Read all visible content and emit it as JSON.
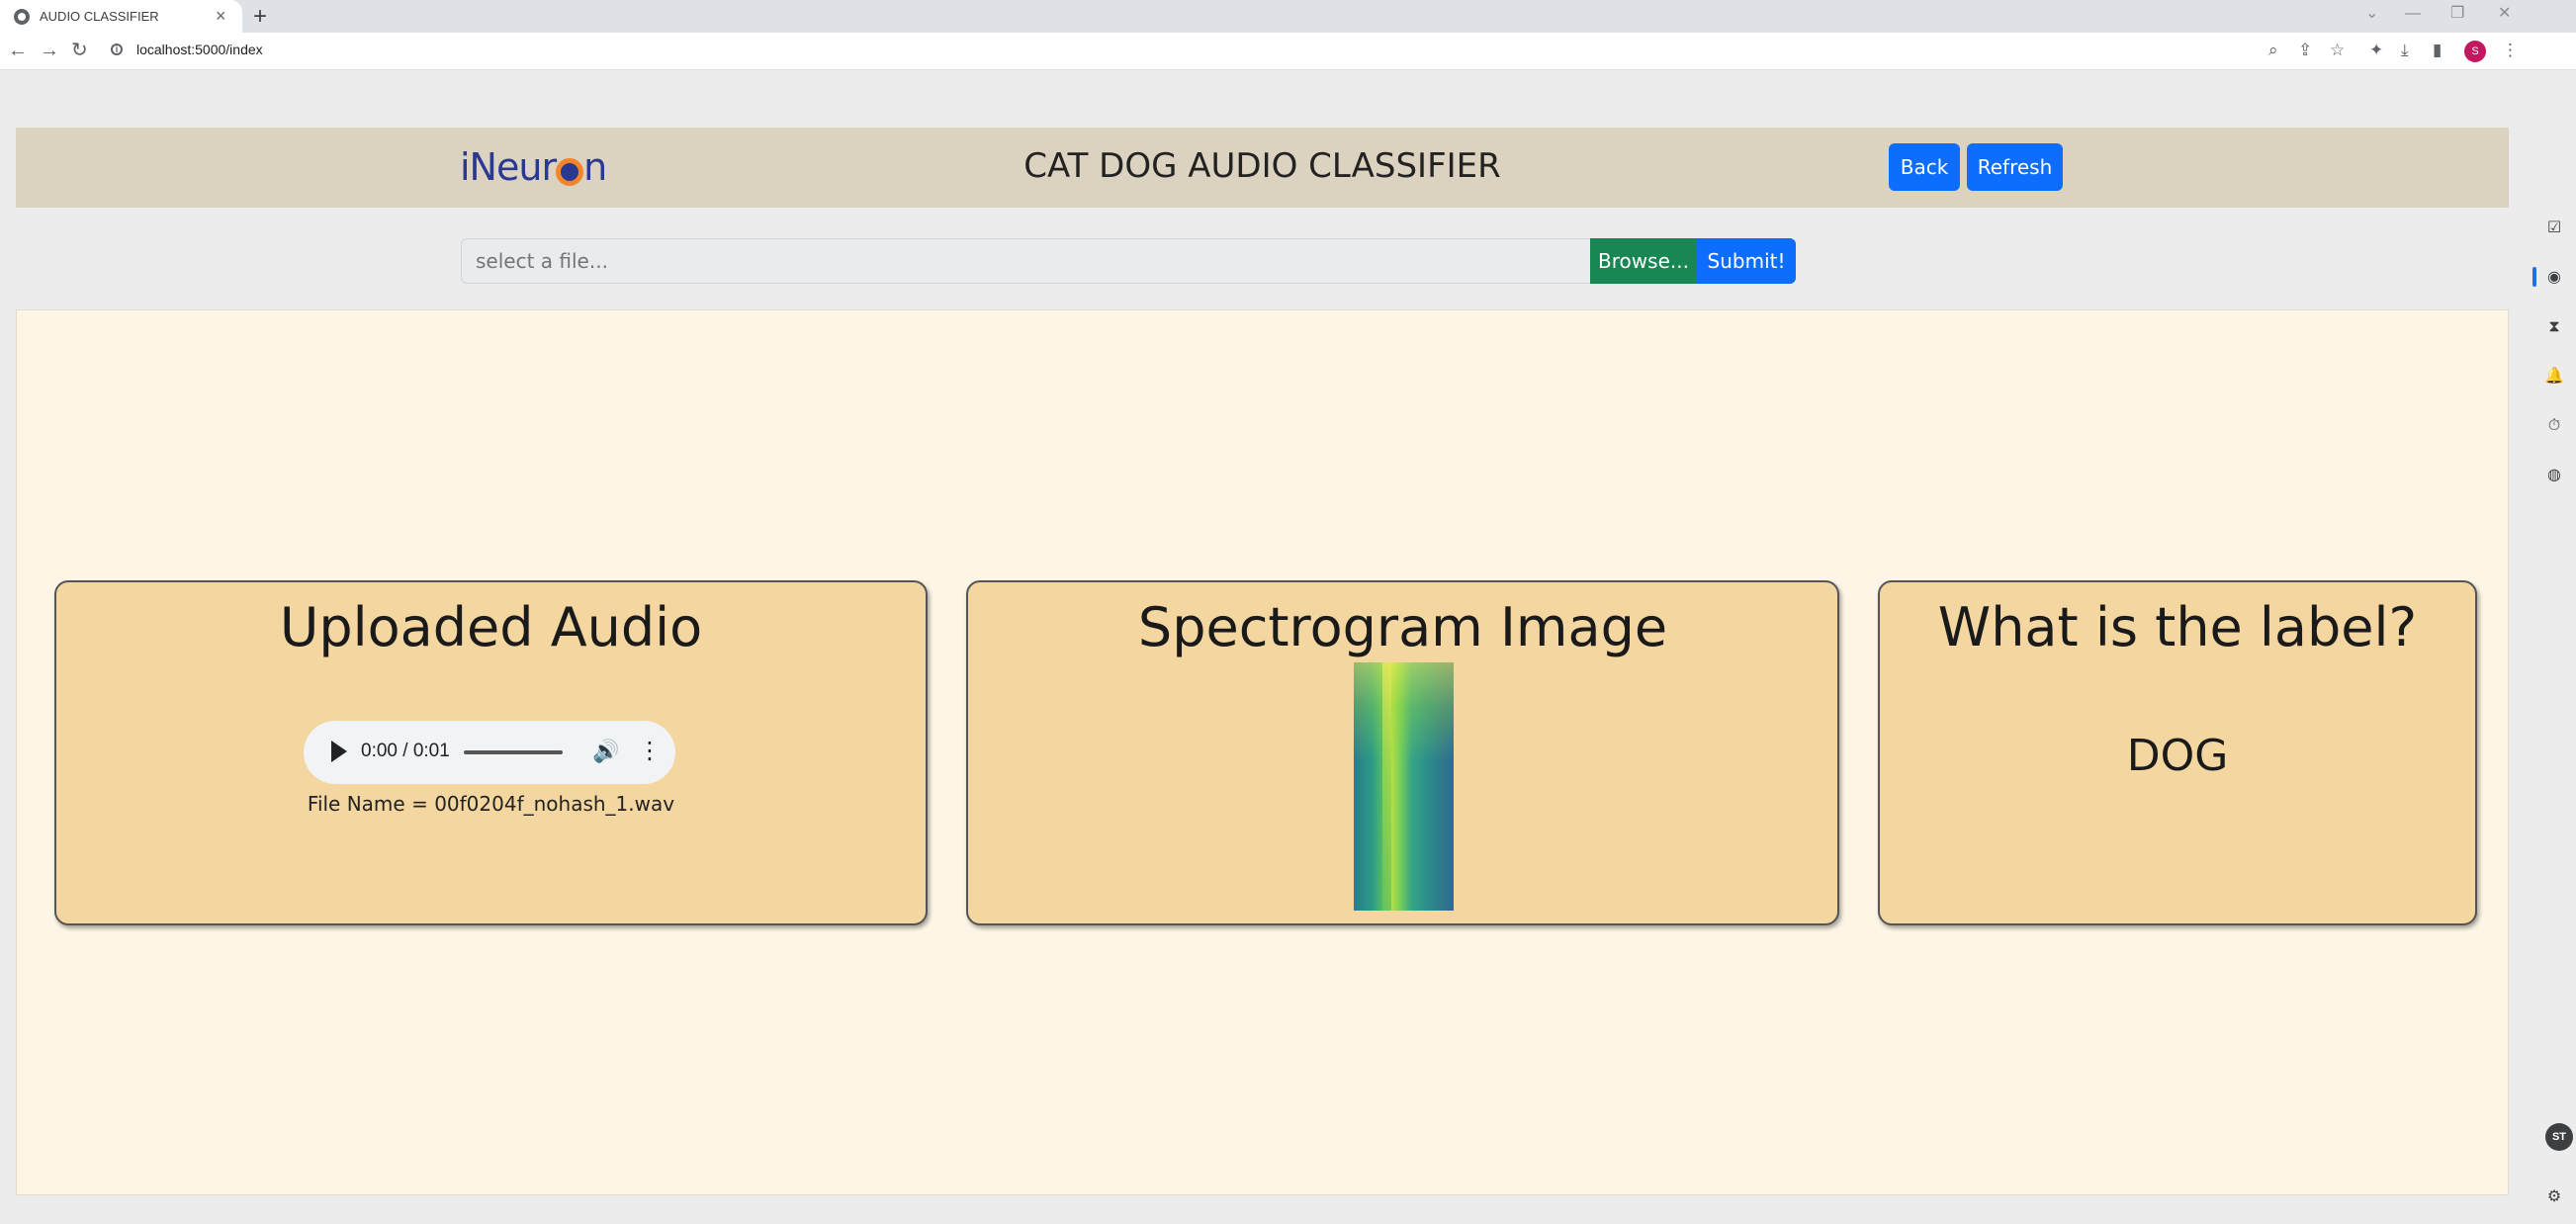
{
  "browser": {
    "tab_title": "AUDIO CLASSIFIER",
    "tab_close": "×",
    "new_tab": "+",
    "url": "localhost:5000/index",
    "profile_initial": "S",
    "window_controls": {
      "minimize": "—",
      "restore": "❐",
      "close": "✕",
      "tabsearch": "⌄"
    },
    "nav": {
      "back": "←",
      "forward": "→",
      "reload": "↻"
    },
    "toolbar_icons": {
      "zoom": "⌕",
      "share": "⇪",
      "bookmark": "☆",
      "extensions": "✦",
      "downloads": "⤓",
      "sidepanel": "▮",
      "menu": "⋮"
    }
  },
  "side_panel": {
    "icons": [
      "check-icon",
      "chrome-icon",
      "hourglass-icon",
      "bell-icon",
      "timer-icon",
      "globe-icon"
    ],
    "icon_glyphs": [
      "☑",
      "◉",
      "⧗",
      "🔔",
      "⏱",
      "◍"
    ],
    "profile_initials": "ST",
    "settings_glyph": "⚙"
  },
  "header": {
    "logo_pre": "iNeur",
    "logo_post": "n",
    "title": "CAT DOG AUDIO CLASSIFIER",
    "back_label": "Back",
    "refresh_label": "Refresh"
  },
  "upload": {
    "placeholder": "select a file...",
    "browse_label": "Browse...",
    "submit_label": "Submit!"
  },
  "cards": {
    "audio": {
      "title": "Uploaded Audio",
      "time": "0:00 / 0:01",
      "file_name": "File Name = 00f0204f_nohash_1.wav"
    },
    "spectrogram": {
      "title": "Spectrogram Image"
    },
    "label": {
      "title": "What is the label?",
      "value": "DOG"
    }
  },
  "colors": {
    "header_bg": "#dbd2c0",
    "main_bg": "#fdf6e7",
    "card_bg": "#f4d6a0",
    "primary": "#0d6efd",
    "success": "#198754"
  }
}
